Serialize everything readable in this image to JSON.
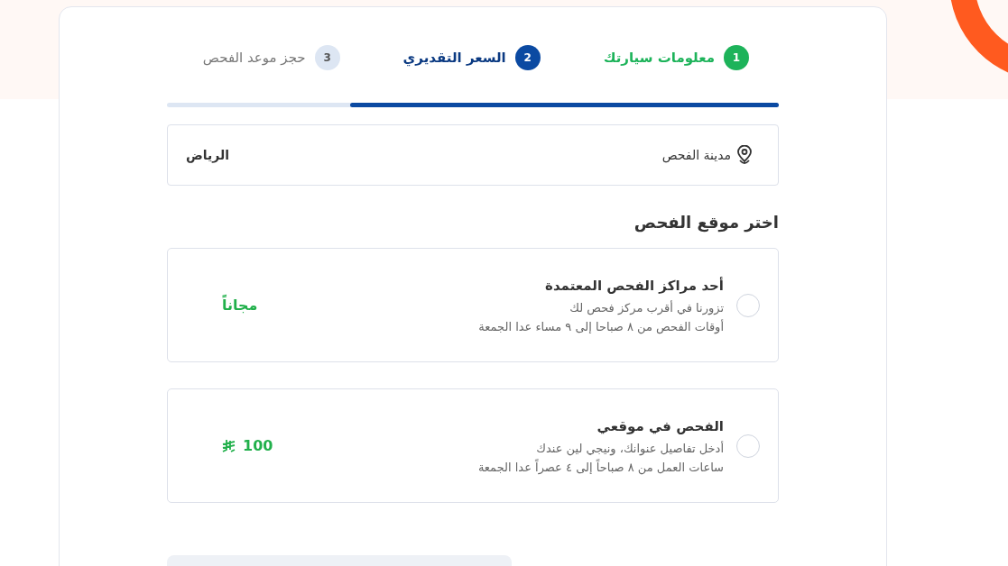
{
  "steps": [
    {
      "number": "1",
      "label": "معلومات سيارتك",
      "kind": "done"
    },
    {
      "number": "2",
      "label": "السعر التقديري",
      "kind": "current"
    },
    {
      "number": "3",
      "label": "حجز موعد الفحص",
      "kind": "upcoming"
    }
  ],
  "progress": {
    "level": 0.7
  },
  "city": {
    "label": "مدينة الفحص",
    "value": "الرياض"
  },
  "section_title": "اختر موقع الفحص",
  "options": [
    {
      "title": "أحد مراكز الفحص المعتمدة",
      "lines": [
        "تزورنا في أقرب مركز فحص لك",
        "أوقات الفحص من ٨ صباحا إلى ٩ مساء عدا الجمعة"
      ],
      "price": "مجاناً",
      "currency_icon": false,
      "selected": false
    },
    {
      "title": "الفحص في موقعي",
      "lines": [
        "أدخل تفاصيل عنوانك، ونيجي لين عندك",
        "ساعات العمل من ٨ صباحاً إلى ٤ عصراً عدا الجمعة"
      ],
      "price": "100",
      "currency_icon": true,
      "selected": false
    }
  ]
}
